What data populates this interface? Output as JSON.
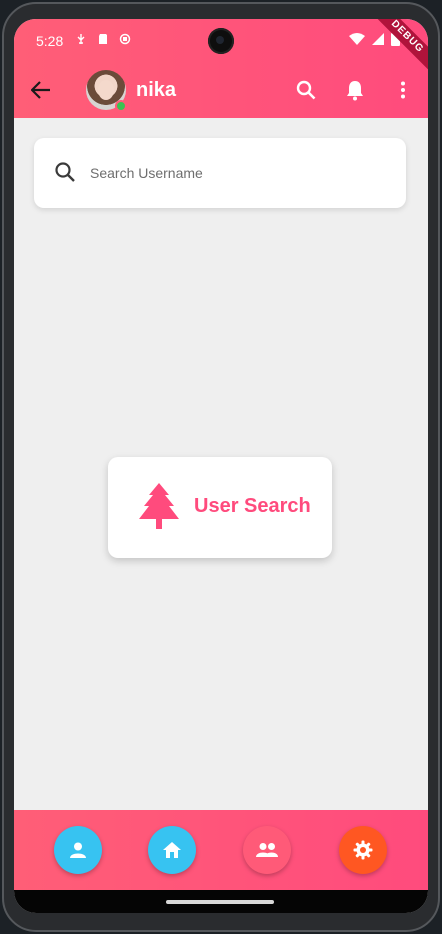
{
  "status_bar": {
    "time": "5:28",
    "icons": [
      "usb-debug-icon",
      "sd-card-icon",
      "sync-icon",
      "wifi-icon",
      "signal-icon",
      "battery-icon"
    ],
    "debug_banner": "DEBUG"
  },
  "app_bar": {
    "title": "nika",
    "actions": [
      "search-icon",
      "bell-icon",
      "more-vert-icon"
    ]
  },
  "search": {
    "placeholder": "Search Username",
    "value": ""
  },
  "empty_state": {
    "label": "User Search",
    "icon": "tree-icon"
  },
  "bottom_nav": {
    "items": [
      {
        "icon": "person-icon",
        "color": "#37c3f1"
      },
      {
        "icon": "home-icon",
        "color": "#37c3f1"
      },
      {
        "icon": "group-icon",
        "color": "#ff5a78"
      },
      {
        "icon": "settings-icon",
        "color": "#ff5722"
      }
    ]
  },
  "colors": {
    "brand_pink": "#ff4b7d",
    "online_green": "#3cc152"
  }
}
